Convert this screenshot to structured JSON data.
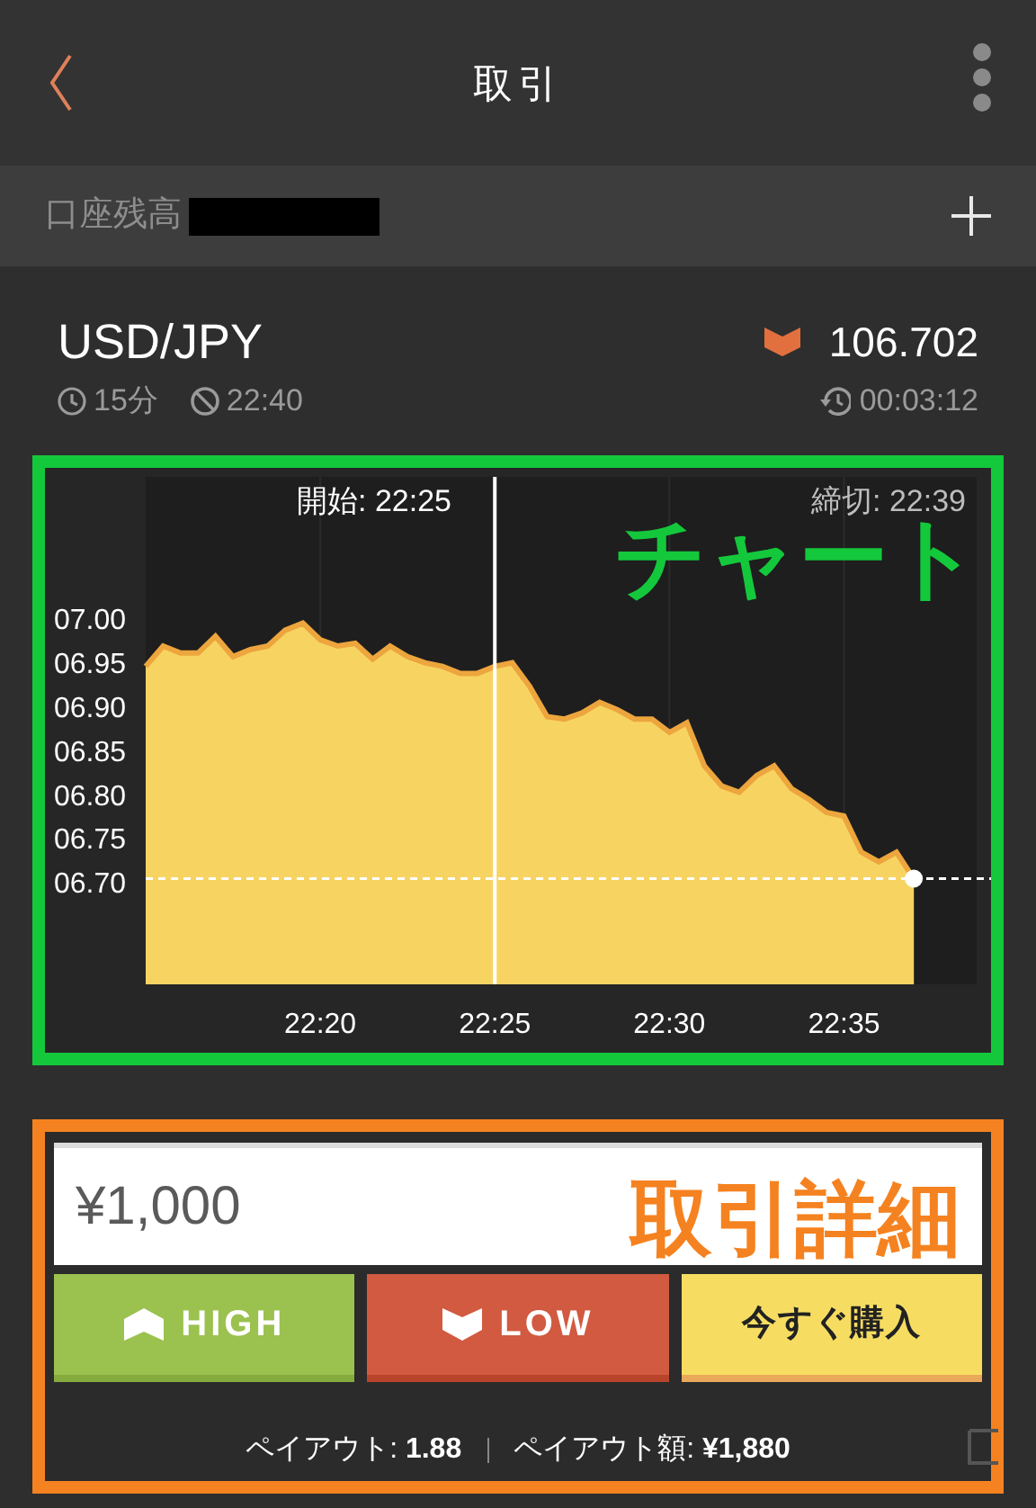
{
  "header": {
    "title": "取引"
  },
  "balance": {
    "label": "口座残高"
  },
  "instrument": {
    "symbol": "USD/JPY",
    "price_down": true,
    "price": "106.702",
    "duration": "15分",
    "cutoff": "22:40",
    "remaining": "00:03:12"
  },
  "chart": {
    "overlay_label": "チャート",
    "start_label": "開始: 22:25",
    "end_label": "締切: 22:39",
    "chart_data": {
      "type": "area",
      "ylim": [
        6.584,
        7.16
      ],
      "grid": true,
      "ref_lines": [
        {
          "axis": "y",
          "value": 6.704
        }
      ],
      "yticks": [
        {
          "value": 7.0,
          "label": "07.00"
        },
        {
          "value": 6.95,
          "label": "06.95"
        },
        {
          "value": 6.9,
          "label": "06.90"
        },
        {
          "value": 6.85,
          "label": "06.85"
        },
        {
          "value": 6.8,
          "label": "06.80"
        },
        {
          "value": 6.75,
          "label": "06.75"
        },
        {
          "value": 6.7,
          "label": "06.70"
        }
      ],
      "categories": [
        null,
        null,
        null,
        null,
        null,
        null,
        null,
        null,
        null,
        null,
        "22:20",
        null,
        null,
        null,
        null,
        null,
        null,
        null,
        null,
        null,
        "22:25",
        null,
        null,
        null,
        null,
        null,
        null,
        null,
        null,
        null,
        "22:30",
        null,
        null,
        null,
        null,
        null,
        null,
        null,
        null,
        null,
        "22:35",
        null,
        null,
        null,
        null
      ],
      "series": [
        {
          "color": "#eda53d",
          "values": [
            6.945,
            6.968,
            6.96,
            6.96,
            6.979,
            6.956,
            6.964,
            6.968,
            6.986,
            6.994,
            6.975,
            6.968,
            6.971,
            6.953,
            6.968,
            6.956,
            6.949,
            6.945,
            6.937,
            6.937,
            6.945,
            6.949,
            6.922,
            6.888,
            6.885,
            6.892,
            6.904,
            6.896,
            6.885,
            6.885,
            6.87,
            6.881,
            6.832,
            6.809,
            6.802,
            6.821,
            6.832,
            6.806,
            6.794,
            6.779,
            6.775,
            6.734,
            6.723,
            6.734,
            6.704
          ]
        }
      ]
    }
  },
  "trade": {
    "overlay_label": "取引詳細",
    "amount": "¥1,000",
    "buttons": [
      {
        "kind": "high",
        "label": "HIGH"
      },
      {
        "kind": "low",
        "label": "LOW"
      },
      {
        "kind": "buy_now",
        "label": "今すぐ購入"
      }
    ],
    "payout": "ペイアウト: **1.88**",
    "payout_amount": "ペイアウト額: **¥1,880**"
  }
}
